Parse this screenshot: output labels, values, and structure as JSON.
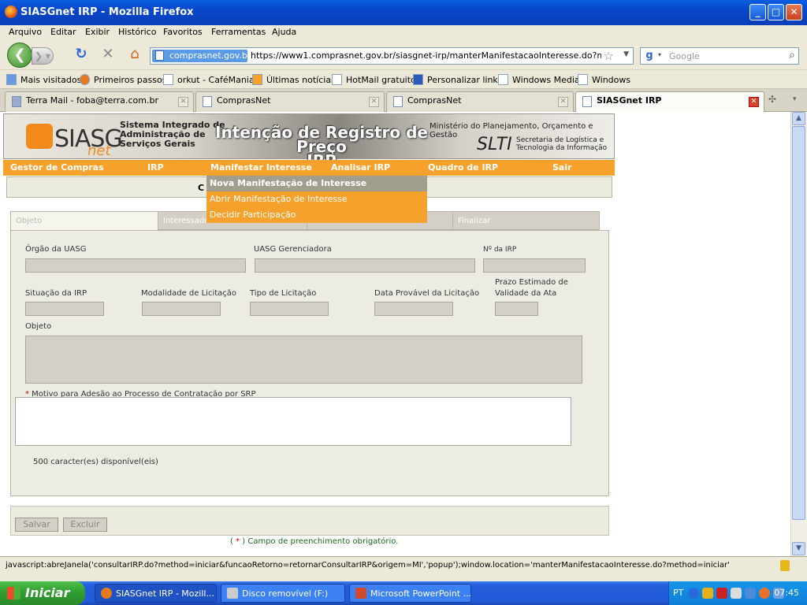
{
  "window": {
    "title": "SIASGnet IRP - Mozilla Firefox"
  },
  "menubar": [
    "Arquivo",
    "Editar",
    "Exibir",
    "Histórico",
    "Favoritos",
    "Ferramentas",
    "Ajuda"
  ],
  "navbar": {
    "site_badge": "comprasnet.gov.br",
    "url": "https://www1.comprasnet.gov.br/siasgnet-irp/manterManifestacaoInteresse.do?method=in",
    "search_placeholder": "Google"
  },
  "bookmarks": [
    "Mais visitados",
    "Primeiros passos",
    "orkut - CaféMania",
    "Últimas notícias",
    "HotMail gratuito",
    "Personalizar links",
    "Windows Media",
    "Windows"
  ],
  "tabs": [
    "Terra Mail - foba@terra.com.br",
    "ComprasNet",
    "ComprasNet",
    "SIASGnet IRP"
  ],
  "banner": {
    "logo_siasg": "SIASG",
    "logo_net": "net",
    "system_line1": "Sistema Integrado de",
    "system_line2": "Administração de",
    "system_line3": "Serviços Gerais",
    "title_line1": "Intenção de Registro de Preço",
    "title_line2": "IRP",
    "ministry": "Ministério do Planejamento, Orçamento e Gestão",
    "slti": "SLTI",
    "slti_line1": "Secretaria de Logística e",
    "slti_line2": "Tecnologia da Informação"
  },
  "mainmenu": [
    "Gestor de Compras",
    "IRP",
    "Manifestar Interesse",
    "Analisar IRP",
    "Quadro de IRP",
    "Sair"
  ],
  "graybar_text": "C",
  "dropdown": [
    "Nova Manifestação de Interesse",
    "Abrir Manifestação de Interesse",
    "Decidir Participação"
  ],
  "steps": [
    "Objeto",
    "Interessado",
    "Finalizar"
  ],
  "form": {
    "orgao": "Órgão da UASG",
    "uasg_ger": "UASG Gerenciadora",
    "num_irp": "Nº da IRP",
    "situacao": "Situação da IRP",
    "modalidade": "Modalidade de Licitação",
    "tipo": "Tipo de Licitação",
    "data_prov": "Data Provável da Licitação",
    "prazo1": "Prazo Estimado de",
    "prazo2": "Validade da Ata",
    "objeto": "Objeto",
    "motivo_star": "*",
    "motivo": " Motivo para Adesão ao Processo de Contratação por SRP",
    "chars": "500  caracter(es) disponível(eis)"
  },
  "buttons": {
    "salvar": "Salvar",
    "excluir": "Excluir"
  },
  "note": {
    "open": "( ",
    "star": "*",
    "close": " ) Campo de preenchimento obrigatório."
  },
  "statusbar": "javascript:abreJanela('consultarIRP.do?method=iniciar&funcaoRetorno=retornarConsultarIRP&origem=MI','popup');window.location='manterManifestacaoInteresse.do?method=iniciar'",
  "taskbar": {
    "start": "Iniciar",
    "tasks": [
      "SIASGnet IRP - Mozill...",
      "Disco removível (F:)",
      "Microsoft PowerPoint ..."
    ],
    "lang": "PT",
    "clock": "07:45"
  },
  "colors": {
    "accent": "#f5a12c",
    "titlebar": "#0a4fd0",
    "dropdown_selected": "#a29e8e"
  }
}
